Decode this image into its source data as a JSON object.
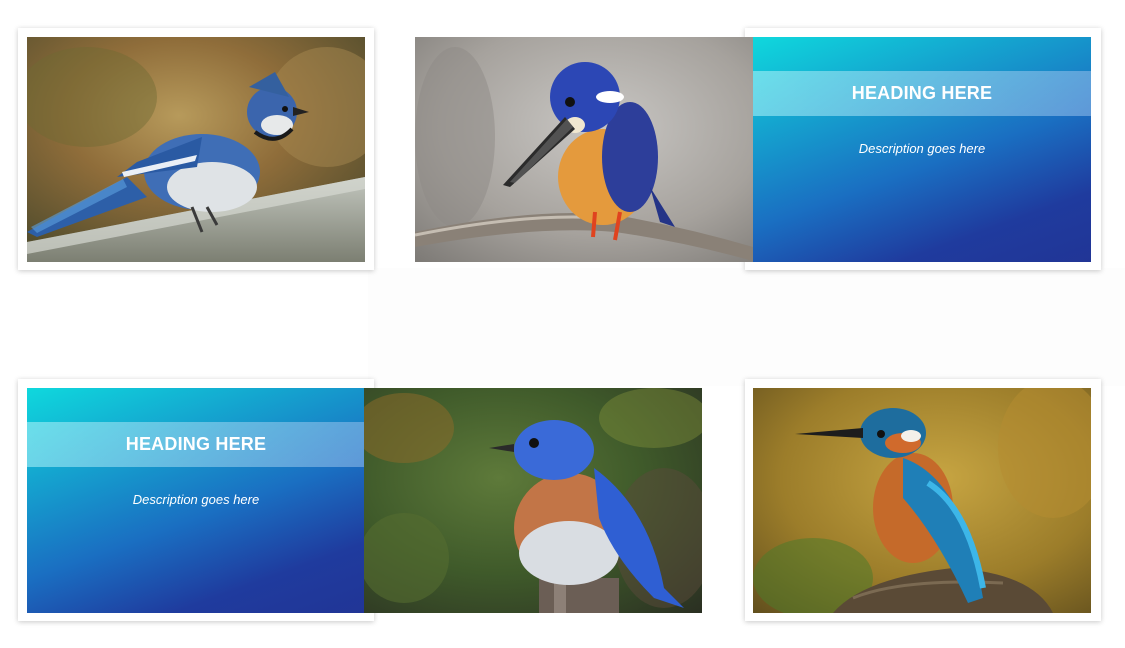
{
  "gallery": {
    "photos": [
      {
        "subject": "blue jay on wooden rail"
      },
      {
        "subject": "azure kingfisher on branch"
      },
      {
        "subject": "eastern bluebird on post"
      },
      {
        "subject": "common kingfisher on stump"
      }
    ],
    "overlays": [
      {
        "heading": "HEADING HERE",
        "description": "Description goes here"
      },
      {
        "heading": "HEADING HERE",
        "description": "Description goes here"
      }
    ]
  },
  "colors": {
    "overlay_top": "#0fd8dd",
    "overlay_bottom": "#213596",
    "card_bg": "#ffffff"
  }
}
